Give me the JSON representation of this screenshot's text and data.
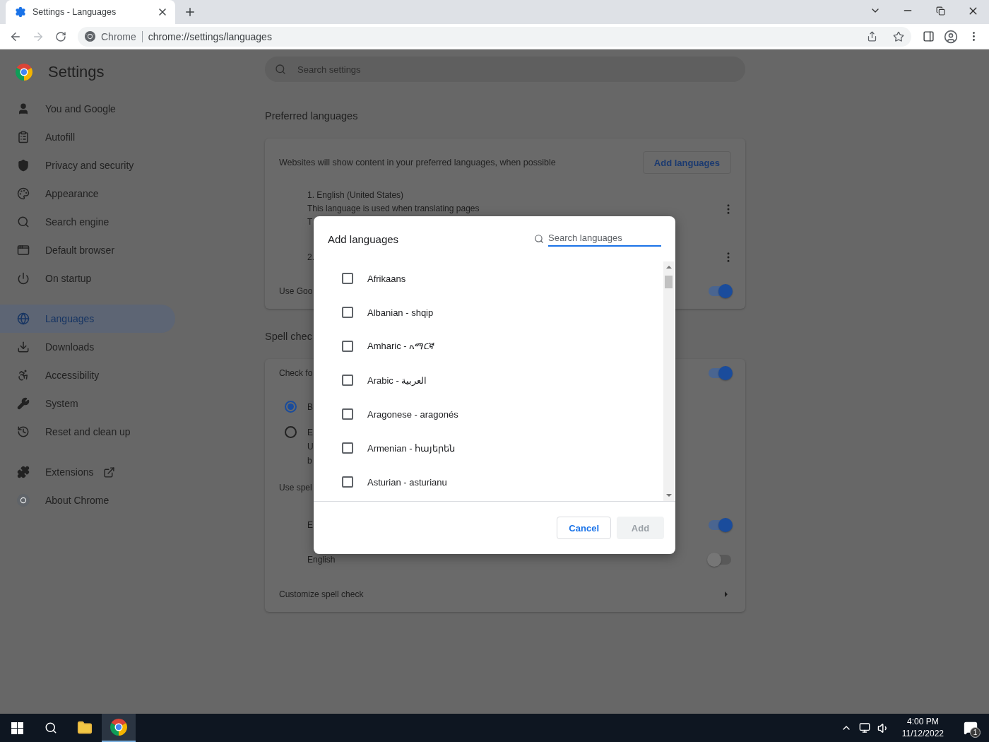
{
  "browser": {
    "tab": {
      "title": "Settings - Languages"
    },
    "address": {
      "origin": "Chrome",
      "url": "chrome://settings/languages"
    }
  },
  "sidebar": {
    "title": "Settings",
    "groups": [
      {
        "items": [
          {
            "label": "You and Google",
            "kind": "page",
            "selected": false
          },
          {
            "label": "Autofill",
            "kind": "page",
            "selected": false
          },
          {
            "label": "Privacy and security",
            "kind": "page",
            "selected": false
          },
          {
            "label": "Appearance",
            "kind": "page",
            "selected": false
          },
          {
            "label": "Search engine",
            "kind": "page",
            "selected": false
          },
          {
            "label": "Default browser",
            "kind": "page",
            "selected": false
          },
          {
            "label": "On startup",
            "kind": "page",
            "selected": false
          }
        ]
      },
      {
        "items": [
          {
            "label": "Languages",
            "kind": "page",
            "selected": true
          },
          {
            "label": "Downloads",
            "kind": "page",
            "selected": false
          },
          {
            "label": "Accessibility",
            "kind": "page",
            "selected": false
          },
          {
            "label": "System",
            "kind": "page",
            "selected": false
          },
          {
            "label": "Reset and clean up",
            "kind": "page",
            "selected": false
          }
        ]
      },
      {
        "items": [
          {
            "label": "Extensions",
            "kind": "external",
            "selected": false
          },
          {
            "label": "About Chrome",
            "kind": "page",
            "selected": false
          }
        ]
      }
    ]
  },
  "search": {
    "placeholder": "Search settings"
  },
  "preferred": {
    "heading": "Preferred languages",
    "description": "Websites will show content in your preferred languages, when possible",
    "add_button": "Add languages",
    "languages": [
      {
        "lines": [
          "1. English (United States)",
          "This language is used when translating pages",
          "T"
        ]
      },
      {
        "lines": [
          "2."
        ]
      }
    ],
    "translate_row": {
      "label": "Use Goo",
      "on": true
    }
  },
  "spell": {
    "heading": "Spell chec",
    "toggle": {
      "label": "Check fo",
      "on": true
    },
    "options": [
      {
        "lines": [
          "B"
        ],
        "selected": true
      },
      {
        "lines": [
          "E",
          "U",
          "b"
        ],
        "selected": false
      }
    ],
    "languages_heading": "Use spel",
    "languages": [
      {
        "label": "E",
        "on": true
      },
      {
        "label": "English",
        "on": false
      }
    ],
    "customize": "Customize spell check"
  },
  "dialog": {
    "title": "Add languages",
    "search_placeholder": "Search languages",
    "languages": [
      {
        "label": "Afrikaans",
        "checked": false
      },
      {
        "label": "Albanian - shqip",
        "checked": false
      },
      {
        "label": "Amharic - አማርኛ",
        "checked": false
      },
      {
        "label": "Arabic - العربية",
        "checked": false
      },
      {
        "label": "Aragonese - aragonés",
        "checked": false
      },
      {
        "label": "Armenian - հայերեն",
        "checked": false
      },
      {
        "label": "Asturian - asturianu",
        "checked": false
      }
    ],
    "cancel": "Cancel",
    "add": {
      "label": "Add",
      "disabled": true
    }
  },
  "taskbar": {
    "time": "4:00 PM",
    "date": "11/12/2022",
    "notifications": "1"
  }
}
